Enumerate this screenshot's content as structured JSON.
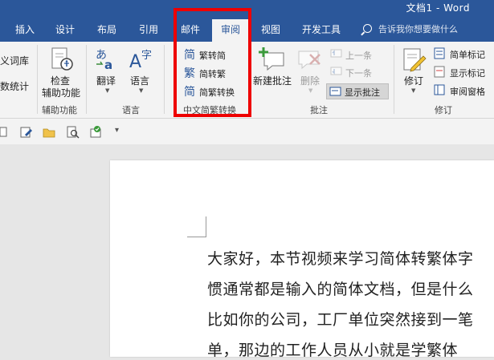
{
  "titlebar": {
    "doc_title": "文档1  -  Word"
  },
  "tabs": [
    {
      "label": "插入"
    },
    {
      "label": "设计"
    },
    {
      "label": "布局"
    },
    {
      "label": "引用"
    },
    {
      "label": "邮件"
    },
    {
      "label": "审阅",
      "active": true
    },
    {
      "label": "视图"
    },
    {
      "label": "开发工具"
    }
  ],
  "tell_me": {
    "placeholder": "告诉我你想要做什么"
  },
  "ribbon": {
    "proofing_partial": {
      "item1": "义词库",
      "item2": "数统计"
    },
    "accessibility": {
      "button": "检查\n辅助功能",
      "line1": "检查",
      "line2": "辅助功能",
      "group_label": "辅助功能"
    },
    "language": {
      "translate": "翻译",
      "language": "语言",
      "group_label": "语言"
    },
    "chinese_conversion": {
      "trad_to_simp": "繁转简",
      "simp_to_trad": "简转繁",
      "convert": "简繁转换",
      "group_label": "中文简繁转换"
    },
    "comments": {
      "new_comment": "新建批注",
      "delete": "删除",
      "previous": "上一条",
      "next": "下一条",
      "show_comments": "显示批注",
      "group_label": "批注"
    },
    "tracking": {
      "track_changes": "修订",
      "simple_markup": "简单标记",
      "show_markup": "显示标记",
      "reviewing_pane": "审阅窗格",
      "group_label": "修订"
    }
  },
  "document": {
    "lines": [
      "大家好，本节视频来学习简体转繁体字",
      "惯通常都是输入的简体文档，但是什么",
      "比如你的公司，工厂单位突然接到一笔",
      "单，那边的工作人员从小就是学繁体"
    ]
  },
  "colors": {
    "word_blue": "#2b579a",
    "highlight_red": "#ee0000"
  }
}
